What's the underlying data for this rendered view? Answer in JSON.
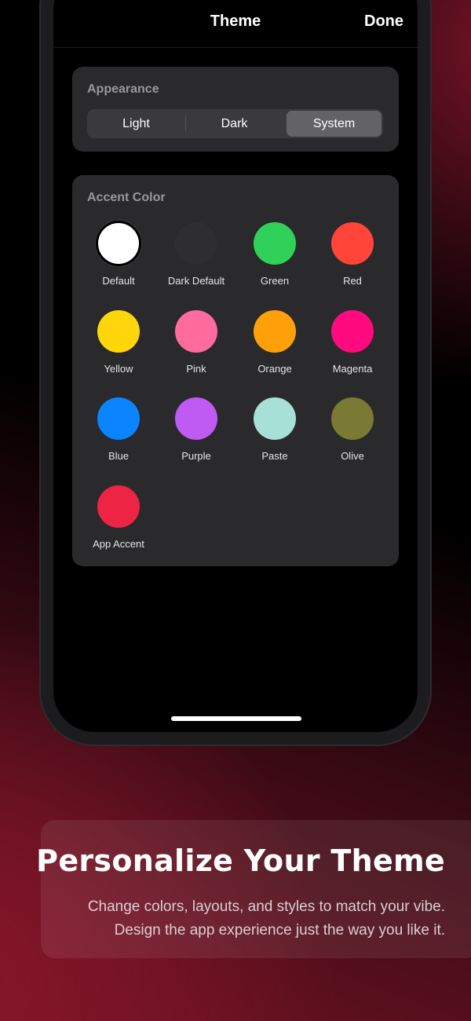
{
  "nav": {
    "title": "Theme",
    "done_label": "Done"
  },
  "appearance": {
    "label": "Appearance",
    "options": [
      "Light",
      "Dark",
      "System"
    ],
    "selected": "System"
  },
  "accent": {
    "label": "Accent Color",
    "selected": "Default",
    "colors": [
      {
        "name": "Default",
        "hex": "#ffffff"
      },
      {
        "name": "Dark Default",
        "hex": "#2e2e30"
      },
      {
        "name": "Green",
        "hex": "#30d158"
      },
      {
        "name": "Red",
        "hex": "#ff453a"
      },
      {
        "name": "Yellow",
        "hex": "#ffd60a"
      },
      {
        "name": "Pink",
        "hex": "#ff6b9d"
      },
      {
        "name": "Orange",
        "hex": "#ff9f0a"
      },
      {
        "name": "Magenta",
        "hex": "#ff0a7f"
      },
      {
        "name": "Blue",
        "hex": "#0a84ff"
      },
      {
        "name": "Purple",
        "hex": "#bf5af2"
      },
      {
        "name": "Paste",
        "hex": "#a6e0d6"
      },
      {
        "name": "Olive",
        "hex": "#7a7a34"
      },
      {
        "name": "App Accent",
        "hex": "#ee2445"
      }
    ]
  },
  "promo": {
    "title": "Personalize Your Theme",
    "line1": "Change colors, layouts, and styles to match your vibe.",
    "line2": "Design the app experience just the way you like it."
  }
}
